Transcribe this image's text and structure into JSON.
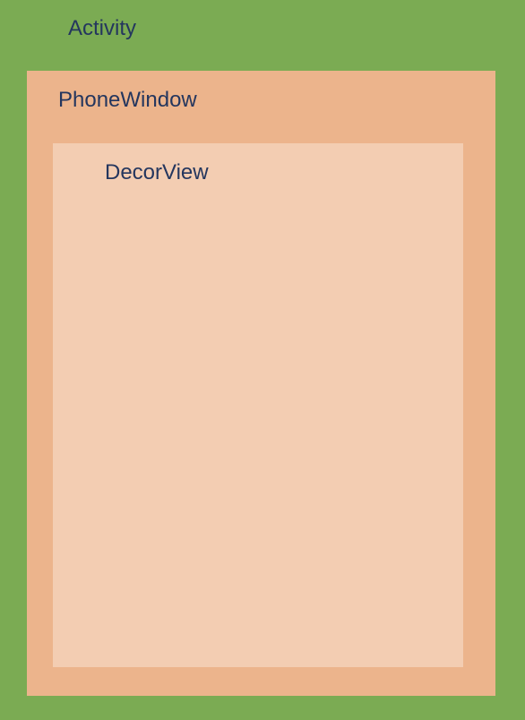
{
  "diagram": {
    "layers": {
      "activity": {
        "label": "Activity",
        "color": "#7bab53"
      },
      "phone_window": {
        "label": "PhoneWindow",
        "color": "#ecb48c"
      },
      "decor_view": {
        "label": "DecorView",
        "color": "#f3cdb2"
      }
    },
    "text_color": "#24365e"
  }
}
